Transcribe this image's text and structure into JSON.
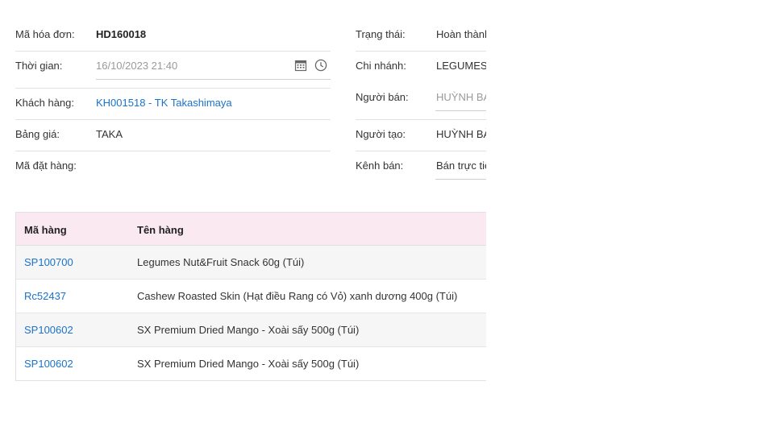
{
  "invoice": {
    "left": {
      "code_label": "Mã hóa đơn:",
      "code_value": "HD160018",
      "time_label": "Thời gian:",
      "time_value": "16/10/2023 21:40",
      "customer_label": "Khách hàng:",
      "customer_value": "KH001518 - TK Takashimaya",
      "pricebook_label": "Bảng giá:",
      "pricebook_value": "TAKA",
      "order_label": "Mã đặt hàng:",
      "order_value": ""
    },
    "right": {
      "status_label": "Trạng thái:",
      "status_value": "Hoàn thành",
      "branch_label": "Chi nhánh:",
      "branch_value": "LEGUMES",
      "seller_label": "Người bán:",
      "seller_value": "HUỲNH BẢ",
      "creator_label": "Người tạo:",
      "creator_value": "HUỲNH BẢ",
      "channel_label": "Kênh bán:",
      "channel_value": "Bán trực tiế"
    }
  },
  "icons": {
    "calendar": "calendar-icon",
    "clock": "clock-icon"
  },
  "table": {
    "headers": [
      "Mã hàng",
      "Tên hàng"
    ],
    "rows": [
      {
        "code": "SP100700",
        "name": "Legumes Nut&Fruit Snack 60g (Túi)"
      },
      {
        "code": "Rc52437",
        "name": "Cashew Roasted Skin (Hạt điều Rang có Vỏ) xanh dương 400g (Túi)"
      },
      {
        "code": "SP100602",
        "name": "SX Premium Dried Mango - Xoài sấy 500g (Túi)"
      },
      {
        "code": "SP100602",
        "name": "SX Premium Dried Mango - Xoài sấy 500g (Túi)"
      }
    ]
  },
  "colors": {
    "link": "#1a73c9",
    "header_bg": "#fbe9f2",
    "row_alt_bg": "#f6f6f7"
  }
}
